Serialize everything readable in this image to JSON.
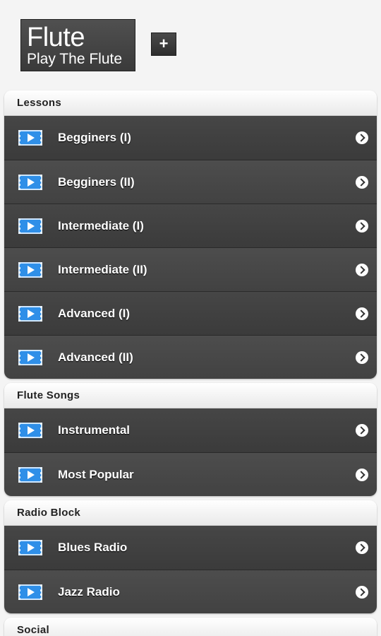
{
  "header": {
    "logo_title": "Flute",
    "logo_subtitle": "Play The Flute",
    "add_button_label": "+"
  },
  "sections": [
    {
      "title": "Lessons",
      "items": [
        {
          "label": "Begginers (I)",
          "icon": "video-play-icon"
        },
        {
          "label": "Begginers (II)",
          "icon": "video-play-icon"
        },
        {
          "label": "Intermediate (I)",
          "icon": "video-play-icon"
        },
        {
          "label": "Intermediate (II)",
          "icon": "video-play-icon"
        },
        {
          "label": "Advanced (I)",
          "icon": "video-play-icon"
        },
        {
          "label": "Advanced (II)",
          "icon": "video-play-icon"
        }
      ]
    },
    {
      "title": "Flute Songs",
      "items": [
        {
          "label": "Instrumental",
          "icon": "video-play-icon"
        },
        {
          "label": "Most Popular",
          "icon": "video-play-icon"
        }
      ]
    },
    {
      "title": "Radio Block",
      "items": [
        {
          "label": "Blues Radio",
          "icon": "video-play-icon"
        },
        {
          "label": "Jazz Radio",
          "icon": "video-play-icon"
        }
      ]
    },
    {
      "title": "Social",
      "items": []
    }
  ],
  "colors": {
    "list_background": "#444444",
    "icon_blue": "#2f8fe8",
    "page_background": "#f4f4f4"
  }
}
